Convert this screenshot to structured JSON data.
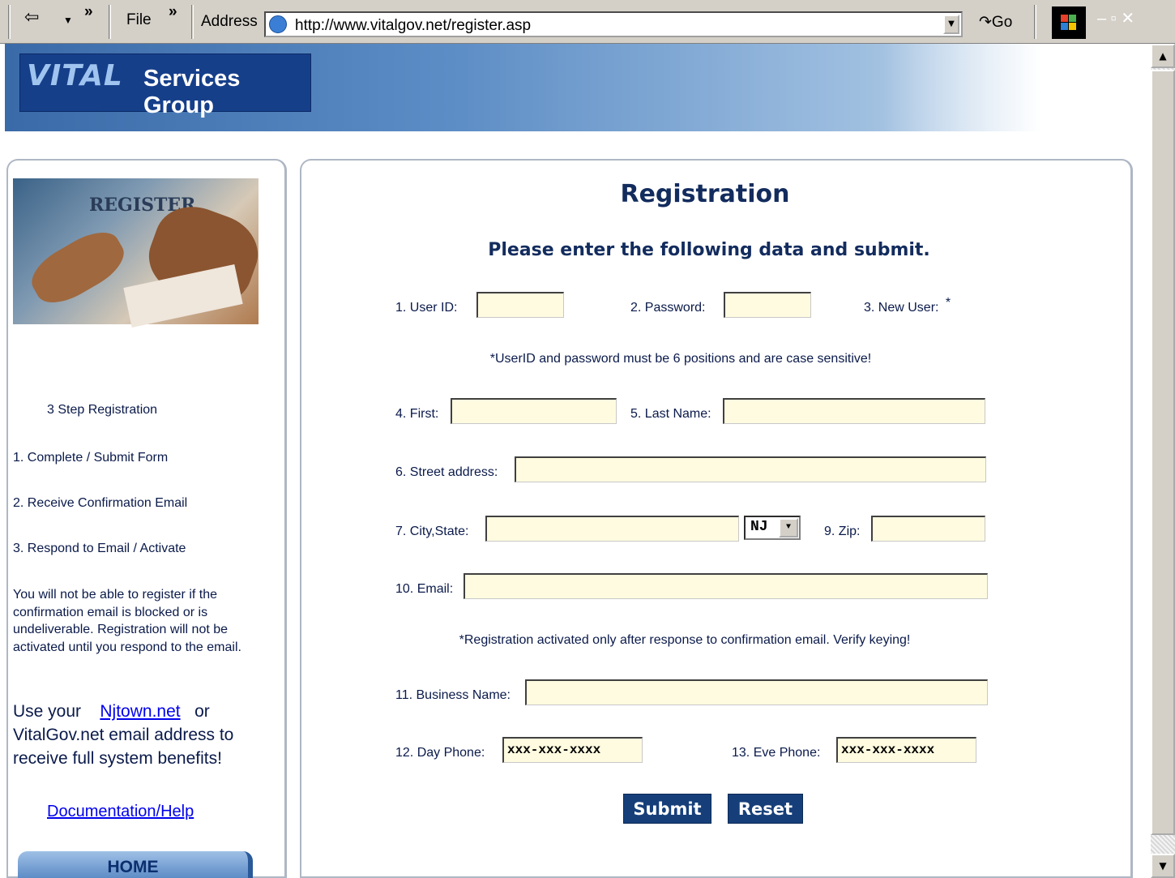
{
  "browser": {
    "back_arrow": "⇦",
    "more": "»",
    "file_menu": "File",
    "more2": "»",
    "address_label": "Address",
    "url": "http://www.vitalgov.net/register.asp",
    "go_label": "Go",
    "win_controls": "–  ▫  ✕"
  },
  "banner": {
    "logo_text": "VITAL",
    "logo_subtitle": "Services Group"
  },
  "sidebar": {
    "image_label": "REGISTER",
    "steps_title": "3 Step Registration",
    "step1": "1. Complete / Submit Form",
    "step2": "2. Receive Confirmation Email",
    "step3": "3. Respond to Email / Activate",
    "warning": "You will not be able to register if the confirmation email is blocked or is undeliverable. Registration will not be activated until you respond to the email.",
    "use_your": "Use your",
    "njtown_link": "Njtown.net",
    "or": "or",
    "benefits_line2": "VitalGov.net email address to",
    "benefits_line3": "receive full system benefits!",
    "doc_link": "Documentation/Help",
    "home_button": "HOME"
  },
  "form": {
    "title": "Registration",
    "subtitle": "Please enter the following data and submit.",
    "userid_label": "1. User ID:",
    "password_label": "2. Password:",
    "newuser_label": "3. New User:",
    "newuser_star": "*",
    "note_userid": "*UserID and password must be 6 positions and are case sensitive!",
    "first_label": "4. First:",
    "lastname_label": "5. Last Name:",
    "street_label": "6. Street address:",
    "citystate_label": "7. City,State:",
    "state_value": "NJ",
    "zip_label": "9. Zip:",
    "email_label": "10. Email:",
    "note_email": "*Registration activated only after response to confirmation email. Verify keying!",
    "business_label": "11. Business Name:",
    "dayphone_label": "12. Day Phone:",
    "dayphone_value": "xxx-xxx-xxxx",
    "evephone_label": "13. Eve Phone:",
    "evephone_value": "xxx-xxx-xxxx",
    "submit_label": "Submit",
    "reset_label": "Reset"
  }
}
